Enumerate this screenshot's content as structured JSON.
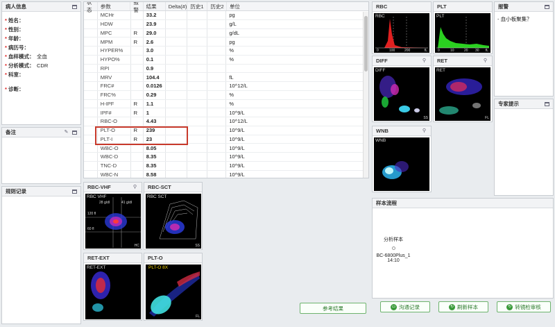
{
  "patient": {
    "title": "病人信息",
    "fields": [
      {
        "key": "姓名：",
        "value": ""
      },
      {
        "key": "性别：",
        "value": ""
      },
      {
        "key": "年龄：",
        "value": ""
      },
      {
        "key": "病历号：",
        "value": ""
      },
      {
        "key": "血样模式：",
        "value": "全血"
      },
      {
        "key": "分析模式：",
        "value": "CDR"
      },
      {
        "key": "科室：",
        "value": ""
      },
      {
        "key": "诊断：",
        "value": ""
      }
    ]
  },
  "remarks": {
    "title": "备注"
  },
  "rules": {
    "title": "规则记录"
  },
  "table": {
    "headers": [
      "状态",
      "参数",
      "报警",
      "结果",
      "Delta(#)",
      "历史1",
      "历史2",
      "单位"
    ],
    "rows": [
      {
        "param": "MCHr",
        "flag": "",
        "result": "33.2",
        "unit": "pg"
      },
      {
        "param": "HDW",
        "flag": "",
        "result": "23.9",
        "unit": "g/L"
      },
      {
        "param": "MPC",
        "flag": "R",
        "result": "29.0",
        "unit": "g/dL"
      },
      {
        "param": "MPM",
        "flag": "R",
        "result": "2.6",
        "unit": "pg"
      },
      {
        "param": "HYPER%",
        "flag": "",
        "result": "3.0",
        "unit": "%"
      },
      {
        "param": "HYPO%",
        "flag": "",
        "result": "0.1",
        "unit": "%"
      },
      {
        "param": "RPI",
        "flag": "",
        "result": "0.9",
        "unit": ""
      },
      {
        "param": "MRV",
        "flag": "",
        "result": "104.4",
        "unit": "fL"
      },
      {
        "param": "FRC#",
        "flag": "",
        "result": "0.0126",
        "unit": "10^12/L"
      },
      {
        "param": "FRC%",
        "flag": "",
        "result": "0.29",
        "unit": "%"
      },
      {
        "param": "H-IPF",
        "flag": "R",
        "result": "1.1",
        "unit": "%"
      },
      {
        "param": "IPF#",
        "flag": "R",
        "result": "1",
        "unit": "10^9/L"
      },
      {
        "param": "RBC-O",
        "flag": "",
        "result": "4.43",
        "unit": "10^12/L"
      },
      {
        "param": "PLT-O",
        "flag": "R",
        "result": "239",
        "unit": "10^9/L"
      },
      {
        "param": "PLT-I",
        "flag": "R",
        "result": "23",
        "unit": "10^9/L"
      },
      {
        "param": "WBC-O",
        "flag": "",
        "result": "8.05",
        "unit": "10^9/L"
      },
      {
        "param": "WBC-D",
        "flag": "",
        "result": "8.35",
        "unit": "10^9/L"
      },
      {
        "param": "TNC-D",
        "flag": "",
        "result": "8.35",
        "unit": "10^9/L"
      },
      {
        "param": "WBC-N",
        "flag": "",
        "result": "8.58",
        "unit": "10^9/L"
      },
      {
        "param": "TNC-N",
        "flag": "",
        "result": "",
        "unit": "10^9/L"
      }
    ]
  },
  "plots": {
    "rbc_vhf": {
      "title": "RBC-VHF",
      "inner": "RBC VHF",
      "l1": "28 g/dl",
      "l2": "41 g/dl",
      "l3": "120 fl",
      "l4": "60 fl",
      "ax": "HC"
    },
    "rbc_sct": {
      "title": "RBC-SCT",
      "inner": "RBC SCT",
      "ax": "SS"
    },
    "ret_ext": {
      "title": "RET-EXT",
      "inner": "RET-EXT"
    },
    "plt_o": {
      "title": "PLT-O",
      "inner": "PLT-O 8X",
      "ax": "FL"
    }
  },
  "histos": {
    "rbc": {
      "title": "RBC",
      "inner": "RBC",
      "t0": "0",
      "t1": "100",
      "t2": "200",
      "t3": "fL"
    },
    "plt": {
      "title": "PLT",
      "inner": "PLT",
      "t0": "0",
      "t1": "10",
      "t2": "20",
      "t3": "30",
      "t4": "fL"
    },
    "diff": {
      "title": "DIFF",
      "inner": "DIFF",
      "ax": "SS"
    },
    "ret": {
      "title": "RET",
      "inner": "RET",
      "ax": "FL"
    },
    "wnb": {
      "title": "WNB",
      "inner": "WNB"
    }
  },
  "alarm": {
    "title": "报警",
    "items": [
      "- 血小板聚集？"
    ]
  },
  "expert": {
    "title": "专家提示"
  },
  "flow": {
    "title": "样本流程",
    "step": "分析样本",
    "device": "BC-6800Plus_1",
    "time": "14:10"
  },
  "buttons": {
    "ref": "参考结果",
    "comm": "沟通记录",
    "refresh": "刷新样本",
    "review": "转镜检审核"
  }
}
